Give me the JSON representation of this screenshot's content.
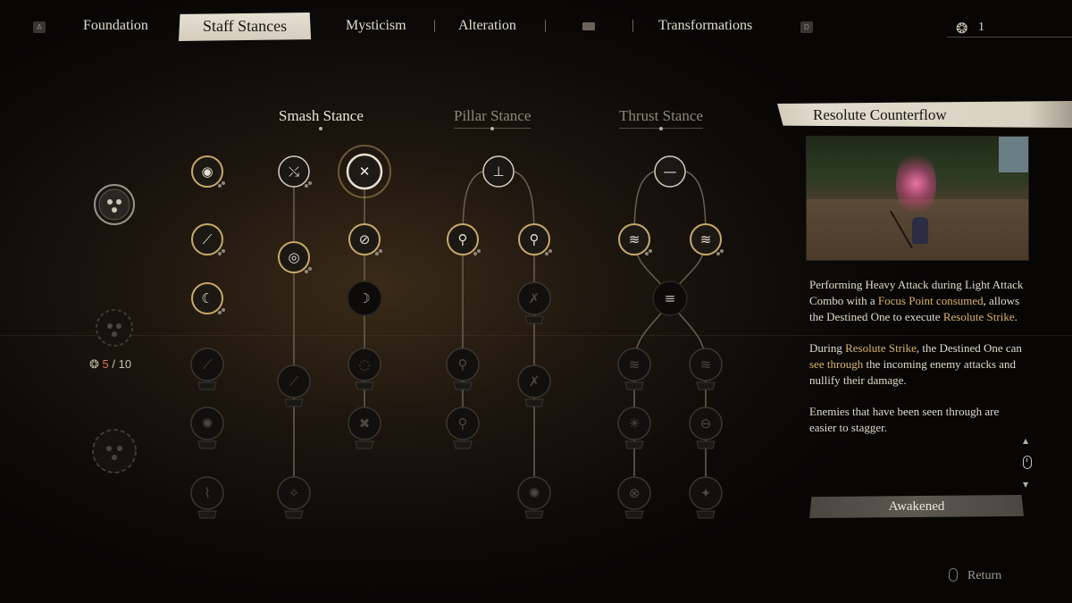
{
  "nav": {
    "left_key": "A",
    "right_key": "D",
    "tabs": [
      "Foundation",
      "Staff Stances",
      "Mysticism",
      "Alteration",
      "Transformations"
    ],
    "active_tab": "Staff Stances",
    "spark_points": "1"
  },
  "left_panel": {
    "count_current": "5",
    "count_sep": "/ 10"
  },
  "stances": [
    {
      "label": "Smash Stance",
      "active": true
    },
    {
      "label": "Pillar Stance",
      "active": false
    },
    {
      "label": "Thrust Stance",
      "active": false
    }
  ],
  "detail": {
    "title": "Resolute Counterflow",
    "paragraphs": [
      [
        {
          "t": "Performing Heavy Attack during Light Attack Combo with a "
        },
        {
          "t": "Focus Point consumed",
          "hl": true
        },
        {
          "t": ", allows the Destined One to execute "
        },
        {
          "t": "Resolute Strike",
          "hl": true
        },
        {
          "t": "."
        }
      ],
      [
        {
          "t": "During "
        },
        {
          "t": "Resolute Strike",
          "hl": true
        },
        {
          "t": ", the Destined One can "
        },
        {
          "t": "see through",
          "hl": true
        },
        {
          "t": " the incoming enemy attacks and nullify their damage."
        }
      ],
      [
        {
          "t": "Enemies that have been seen through are easier to stagger."
        }
      ]
    ],
    "status": "Awakened",
    "highlight_color": "#d8b26a"
  },
  "footer": {
    "return_label": "Return"
  },
  "tree_nodes": [
    {
      "id": "smash-a1",
      "state": "unlocked",
      "icon": "orb-flame-icon"
    },
    {
      "id": "smash-a2",
      "state": "unlocked",
      "icon": "staff-strike-icon"
    },
    {
      "id": "smash-a3",
      "state": "unlocked",
      "icon": "crescent-sweep-icon"
    },
    {
      "id": "smash-a4",
      "state": "locked",
      "icon": "staff-slam-icon"
    },
    {
      "id": "smash-a5",
      "state": "locked",
      "icon": "whirl-strike-icon"
    },
    {
      "id": "smash-a6",
      "state": "locked",
      "icon": "leap-strike-icon"
    },
    {
      "id": "smash-b1",
      "state": "available",
      "icon": "spin-staff-icon"
    },
    {
      "id": "smash-b2",
      "state": "unlocked",
      "icon": "ring-strike-icon"
    },
    {
      "id": "smash-b3",
      "state": "locked",
      "icon": "rising-strike-icon"
    },
    {
      "id": "smash-b4",
      "state": "locked",
      "icon": "ground-smash-icon"
    },
    {
      "id": "smash-c1",
      "state": "selected",
      "icon": "cross-staff-icon"
    },
    {
      "id": "smash-c2",
      "state": "unlocked",
      "icon": "focus-strike-icon"
    },
    {
      "id": "smash-c3",
      "state": "dark",
      "icon": "crescent-icon"
    },
    {
      "id": "smash-c4",
      "state": "locked",
      "icon": "vortex-icon"
    },
    {
      "id": "smash-c5",
      "state": "locked",
      "icon": "cross-burst-icon"
    },
    {
      "id": "pillar-root",
      "state": "available",
      "icon": "pillar-stand-icon"
    },
    {
      "id": "pillar-a1",
      "state": "unlocked",
      "icon": "pole-vault-icon"
    },
    {
      "id": "pillar-a2",
      "state": "locked",
      "icon": "pole-kick-icon"
    },
    {
      "id": "pillar-a3",
      "state": "locked",
      "icon": "pole-slam-icon"
    },
    {
      "id": "pillar-b1",
      "state": "unlocked",
      "icon": "pole-rise-icon"
    },
    {
      "id": "pillar-b2",
      "state": "locked",
      "icon": "pole-spin-icon"
    },
    {
      "id": "pillar-b3",
      "state": "locked",
      "icon": "pole-sweep-icon"
    },
    {
      "id": "pillar-b4",
      "state": "locked",
      "icon": "pole-burst-icon"
    },
    {
      "id": "thrust-root",
      "state": "available",
      "icon": "thrust-line-icon"
    },
    {
      "id": "thrust-a1",
      "state": "unlocked",
      "icon": "lunge-icon"
    },
    {
      "id": "thrust-b1",
      "state": "unlocked",
      "icon": "double-lunge-icon"
    },
    {
      "id": "thrust-mid",
      "state": "dark",
      "icon": "thrust-flurry-icon"
    },
    {
      "id": "thrust-a2",
      "state": "locked",
      "icon": "piercing-thrust-icon"
    },
    {
      "id": "thrust-a3",
      "state": "locked",
      "icon": "thrust-burst-icon"
    },
    {
      "id": "thrust-a4",
      "state": "locked",
      "icon": "spiral-thrust-icon"
    },
    {
      "id": "thrust-b2",
      "state": "locked",
      "icon": "sweep-thrust-icon"
    },
    {
      "id": "thrust-b3",
      "state": "locked",
      "icon": "ring-thrust-icon"
    },
    {
      "id": "thrust-b4",
      "state": "locked",
      "icon": "star-thrust-icon"
    }
  ],
  "colors": {
    "node_gold": "#c9a96a",
    "node_ring": "#d8d0bf",
    "line": "#6a6050"
  }
}
